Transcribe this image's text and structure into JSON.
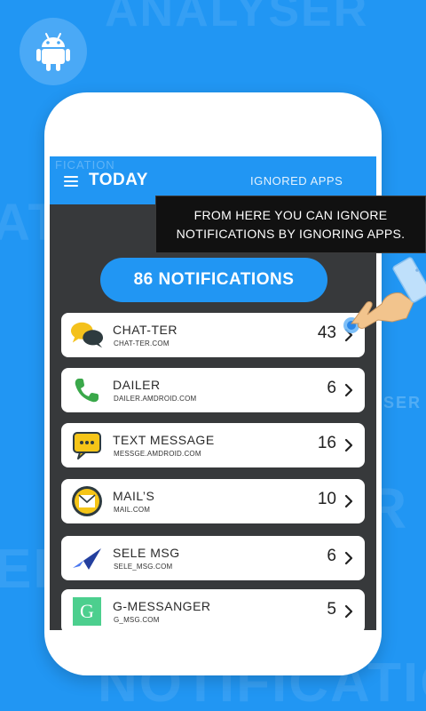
{
  "background": {
    "word_top": "ANALYSER",
    "word_bottom": "NOTIFICATIO",
    "word_left_top": "AT",
    "word_left_bottom": "ER",
    "word_right_mid": "R",
    "word_right_small": "YSER"
  },
  "badge": {
    "icon": "android-icon"
  },
  "app_bar": {
    "ghost_text": "FICATION",
    "title": "TODAY",
    "ignored_tab": "IGNORED APPS",
    "menu_icon": "hamburger-menu-icon"
  },
  "summary": {
    "label": "86 NOTIFICATIONS"
  },
  "tooltip": {
    "line1": "FROM HERE YOU CAN IGNORE",
    "line2": "NOTIFICATIONS BY IGNORING APPS."
  },
  "apps": [
    {
      "name": "CHAT-TER",
      "domain": "CHAT-TER.COM",
      "count": "43",
      "icon": "chat-bubbles-icon"
    },
    {
      "name": "DAILER",
      "domain": "DAILER.AMDROID.COM",
      "count": "6",
      "icon": "phone-icon"
    },
    {
      "name": "TEXT MESSAGE",
      "domain": "MESSGE.AMDROID.COM",
      "count": "16",
      "icon": "message-bubble-icon"
    },
    {
      "name": "MAIL’S",
      "domain": "MAIL.COM",
      "count": "10",
      "icon": "mail-icon"
    },
    {
      "name": "SELE MSG",
      "domain": "SELE_MSG.COM",
      "count": "6",
      "icon": "paper-plane-icon"
    },
    {
      "name": "G-MESSANGER",
      "domain": "G_MSG.COM",
      "count": "5",
      "icon": "g-messenger-icon",
      "icon_letter": "G"
    }
  ],
  "colors": {
    "background": "#2196f3",
    "phone": "#ffffff",
    "screen": "#37393b",
    "accent": "#2196f3",
    "tooltip": "#111111",
    "phone_green": "#3aa84a",
    "mail_yellow": "#f5c518",
    "plane_blue": "#2f57d6",
    "g_green": "#4ccf8e"
  }
}
